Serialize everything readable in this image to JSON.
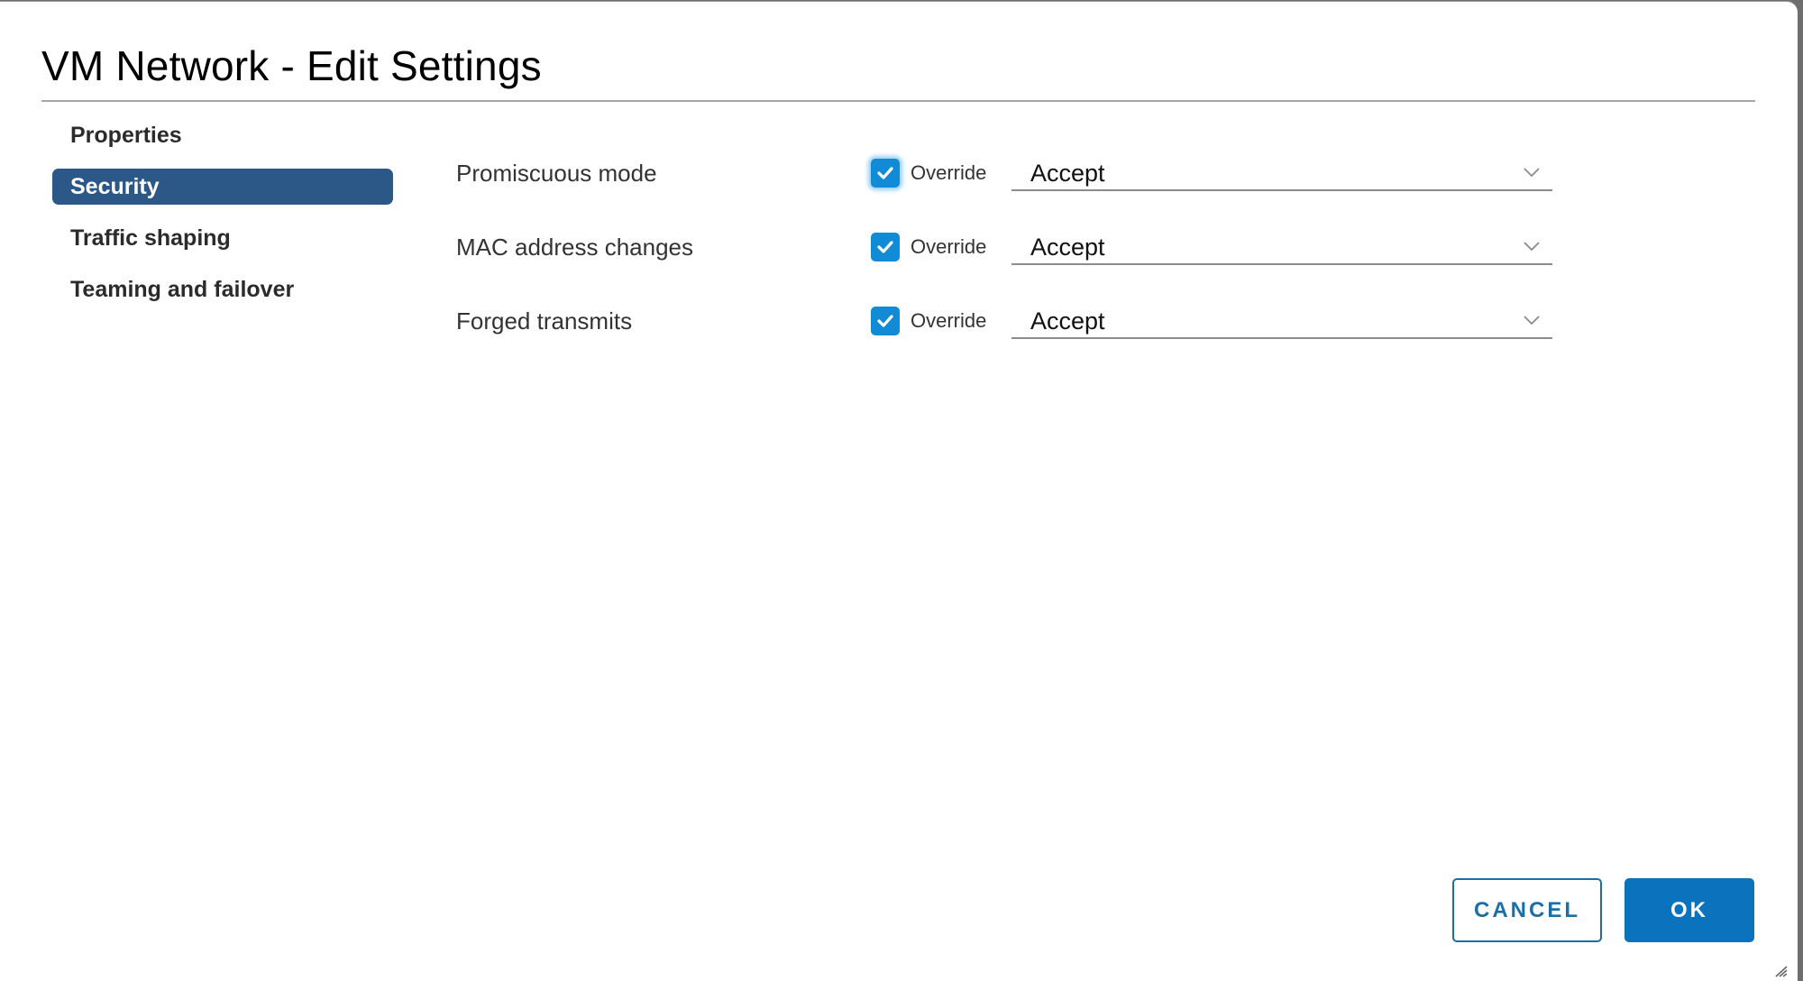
{
  "dialog": {
    "title": "VM Network - Edit Settings"
  },
  "sidebar": {
    "items": [
      {
        "label": "Properties",
        "active": false
      },
      {
        "label": "Security",
        "active": true
      },
      {
        "label": "Traffic shaping",
        "active": false
      },
      {
        "label": "Teaming and failover",
        "active": false
      }
    ]
  },
  "settings": [
    {
      "label": "Promiscuous mode",
      "override_checked": true,
      "override_label": "Override",
      "value": "Accept",
      "icon": "chevron-down-icon"
    },
    {
      "label": "MAC address changes",
      "override_checked": true,
      "override_label": "Override",
      "value": "Accept",
      "icon": "chevron-down-icon"
    },
    {
      "label": "Forged transmits",
      "override_checked": true,
      "override_label": "Override",
      "value": "Accept",
      "icon": "chevron-down-icon"
    }
  ],
  "footer": {
    "cancel_label": "CANCEL",
    "ok_label": "OK"
  },
  "colors": {
    "accent": "#0b73bd",
    "checkbox": "#128bd6",
    "active_nav": "#2b5887"
  }
}
